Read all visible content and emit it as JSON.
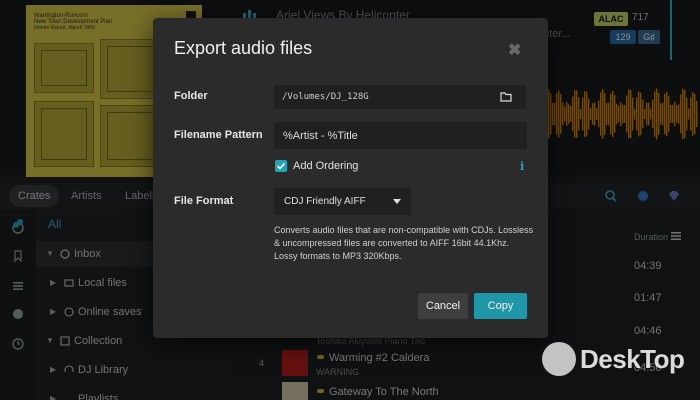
{
  "background": {
    "artwork_text": [
      "Warrington-Runcorn",
      "New Town Development Plan",
      "Interim Report, March 1969"
    ],
    "track_title": "Ariel Views By Helicopter",
    "track_subtitle": "Inter...",
    "badges": {
      "format": "ALAC",
      "sample": "717",
      "bpm": "129",
      "key": "G♯"
    },
    "toolbar_tabs": [
      "Crates",
      "Artists",
      "Labels"
    ],
    "tree_all": "All",
    "tree": [
      {
        "label": "Inbox",
        "expanded": true
      },
      {
        "label": "Local files",
        "expanded": false
      },
      {
        "label": "Online saves",
        "expanded": false
      },
      {
        "label": "Collection",
        "expanded": true
      },
      {
        "label": "DJ Library",
        "expanded": false
      },
      {
        "label": "Playlists",
        "expanded": false
      }
    ],
    "duration_header": "Duration",
    "durations": [
      "04:39",
      "01:47",
      "04:46",
      "04:50",
      "..."
    ],
    "rows": [
      {
        "num": "",
        "title": "",
        "subtitle": "Toshiko Akiyoshi Piano Trio"
      },
      {
        "num": "4",
        "title": "Warming #2 Caldera",
        "subtitle": "WARNING"
      },
      {
        "num": "",
        "title": "Gateway To The North",
        "subtitle": ""
      }
    ]
  },
  "dialog": {
    "title": "Export audio files",
    "close_glyph": "✖",
    "folder_label": "Folder",
    "folder_value": "/Volumes/DJ_128G",
    "pattern_label": "Filename Pattern",
    "pattern_value": "%Artist - %Title",
    "ordering_label": "Add Ordering",
    "ordering_checked": true,
    "info_glyph": "i",
    "format_label": "File Format",
    "format_value": "CDJ Friendly AIFF",
    "description": "Converts audio files that are non-compatible with CDJs. Lossless & uncompressed files are converted to AIFF 16bit 44.1Khz. Lossy formats to MP3 320Kbps.",
    "cancel_label": "Cancel",
    "copy_label": "Copy",
    "accent_color": "#1f97a8"
  },
  "watermark": {
    "text": "DeskTop"
  }
}
